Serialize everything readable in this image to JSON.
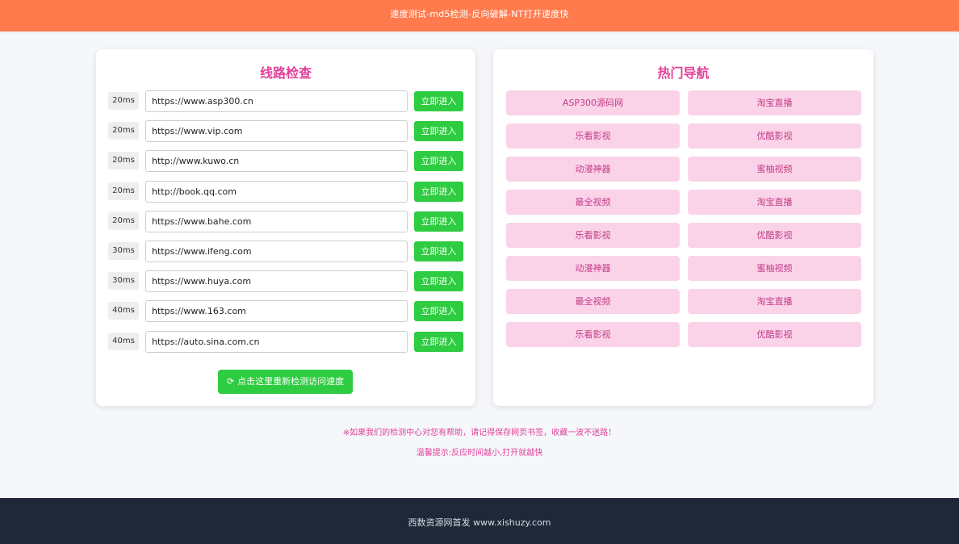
{
  "header": {
    "subtitle": "速度测试-md5检测-反向破解-NT打开速度快"
  },
  "lines_panel": {
    "title": "线路检查",
    "button_label": "立即进入",
    "rows": [
      {
        "latency": "20ms",
        "url": "https://www.asp300.cn"
      },
      {
        "latency": "20ms",
        "url": "https://www.vip.com"
      },
      {
        "latency": "20ms",
        "url": "http://www.kuwo.cn"
      },
      {
        "latency": "20ms",
        "url": "http://book.qq.com"
      },
      {
        "latency": "20ms",
        "url": "https://www.bahe.com"
      },
      {
        "latency": "30ms",
        "url": "https://www.ifeng.com"
      },
      {
        "latency": "30ms",
        "url": "https://www.huya.com"
      },
      {
        "latency": "40ms",
        "url": "https://www.163.com"
      },
      {
        "latency": "40ms",
        "url": "https://auto.sina.com.cn"
      }
    ],
    "retest_label": "点击这里重新检测访问速度",
    "retest_icon": "refresh-icon"
  },
  "nav_panel": {
    "title": "热门导航",
    "items": [
      "ASP300源码网",
      "淘宝直播",
      "乐看影视",
      "优酷影视",
      "动漫神器",
      "蜜柚视频",
      "最全视频",
      "淘宝直播",
      "乐看影视",
      "优酷影视",
      "动漫神器",
      "蜜柚视频",
      "最全视频",
      "淘宝直播",
      "乐看影视",
      "优酷影视"
    ]
  },
  "notices": {
    "line1": "※如果我们的检测中心对您有帮助，请记得保存网页书签，收藏一波不迷路！",
    "line2": "温馨提示:反应时间越小,打开就越快"
  },
  "footer": {
    "text": "西数资源网首发 www.xishuzy.com"
  },
  "colors": {
    "header_bg": "#ff7b4d",
    "accent_pink": "#e2409a",
    "nav_item_bg": "#fbd3e8",
    "button_green": "#2ecc40",
    "footer_bg": "#1e2838"
  }
}
